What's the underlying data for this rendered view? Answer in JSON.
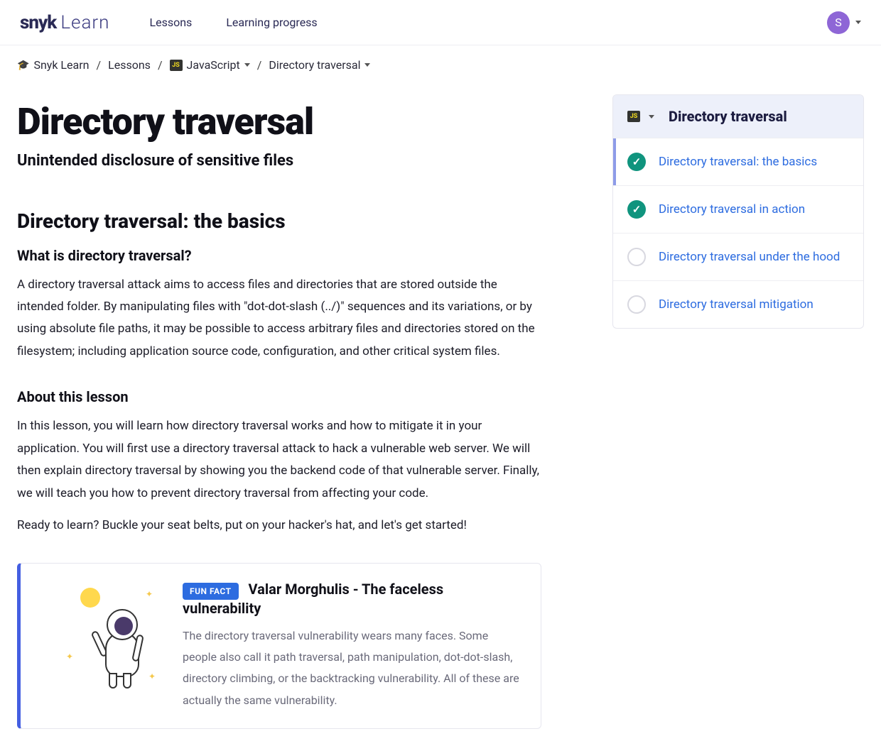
{
  "brand": {
    "primary": "snyk",
    "secondary": "Learn"
  },
  "nav": {
    "lessons": "Lessons",
    "progress": "Learning progress"
  },
  "user": {
    "initial": "S"
  },
  "breadcrumb": {
    "home": "Snyk Learn",
    "lessons": "Lessons",
    "ecosystem": "JavaScript",
    "current": "Directory traversal"
  },
  "page": {
    "title": "Directory traversal",
    "subtitle": "Unintended disclosure of sensitive files"
  },
  "sections": {
    "basics": {
      "heading": "Directory traversal: the basics",
      "q_heading": "What is directory traversal?",
      "q_body": "A directory traversal attack aims to access files and directories that are stored outside the intended folder. By manipulating files with \"dot-dot-slash (../)\" sequences and its variations, or by using absolute file paths, it may be possible to access arbitrary files and directories stored on the filesystem; including application source code, configuration, and other critical system files.",
      "about_heading": "About this lesson",
      "about_body1": "In this lesson, you will learn how directory traversal works and how to mitigate it in your application. You will first use a directory traversal attack to hack a vulnerable web server. We will then explain directory traversal by showing you the backend code of that vulnerable server. Finally, we will teach you how to prevent directory traversal from affecting your code.",
      "about_body2": "Ready to learn? Buckle your seat belts, put on your hacker's hat, and let's get started!"
    }
  },
  "funfact": {
    "badge": "FUN FACT",
    "title": "Valar Morghulis - The faceless vulnerability",
    "body": "The directory traversal vulnerability wears many faces. Some people also call it path traversal, path manipulation, dot-dot-slash, directory climbing, or the backtracking vulnerability. All of these are actually the same vulnerability."
  },
  "sidebar": {
    "title": "Directory traversal",
    "items": [
      {
        "label": "Directory traversal: the basics",
        "done": true,
        "active": true
      },
      {
        "label": "Directory traversal in action",
        "done": true,
        "active": false
      },
      {
        "label": "Directory traversal under the hood",
        "done": false,
        "active": false
      },
      {
        "label": "Directory traversal mitigation",
        "done": false,
        "active": false
      }
    ]
  },
  "icons": {
    "js_badge": "JS"
  }
}
